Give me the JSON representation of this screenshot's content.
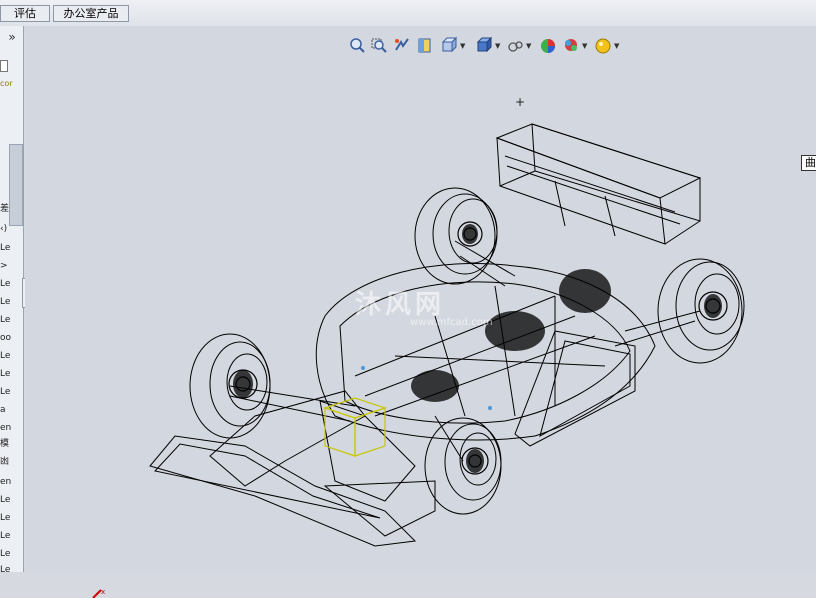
{
  "tabs": [
    {
      "label": "评估"
    },
    {
      "label": "办公室产品"
    }
  ],
  "sidebar": {
    "expand_label": "»",
    "items": [
      {
        "text": "cor"
      },
      {
        "text": "差"
      },
      {
        "text": "‹)"
      },
      {
        "text": "Le"
      },
      {
        "text": ">"
      },
      {
        "text": "Le"
      },
      {
        "text": "Le"
      },
      {
        "text": "Le"
      },
      {
        "text": "oo"
      },
      {
        "text": "Le"
      },
      {
        "text": "Le"
      },
      {
        "text": "Le"
      },
      {
        "text": "a"
      },
      {
        "text": "en"
      },
      {
        "text": "模"
      },
      {
        "text": "凼"
      },
      {
        "text": "en"
      },
      {
        "text": "Le"
      },
      {
        "text": "Le"
      },
      {
        "text": "Le"
      },
      {
        "text": "Le"
      },
      {
        "text": "Le"
      }
    ]
  },
  "view_toolbar": {
    "icons": [
      "zoom-to-fit-icon",
      "zoom-to-area-icon",
      "previous-view-icon",
      "section-view-icon",
      "view-orientation-icon",
      "display-style-icon",
      "hide-show-items-icon",
      "edit-appearance-icon",
      "apply-scene-icon",
      "view-settings-icon"
    ]
  },
  "viewport": {
    "cursor": "+",
    "tooltip": "曲面-输",
    "watermark": "沐风网",
    "watermark_url": "www.mfcad.com"
  },
  "colors": {
    "viewport_bg": "#d3d7df",
    "wireframe": "#000000",
    "selected_box": "#c8c800"
  }
}
